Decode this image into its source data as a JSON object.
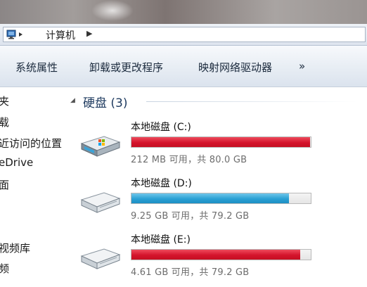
{
  "address": {
    "path": "计算机"
  },
  "toolbar": {
    "buttons": [
      {
        "label": "系统属性"
      },
      {
        "label": "卸载或更改程序"
      },
      {
        "label": "映射网络驱动器"
      }
    ],
    "more": "»"
  },
  "nav": {
    "items": [
      {
        "label": "夹"
      },
      {
        "label": "载"
      },
      {
        "label": "近访问的位置"
      },
      {
        "label": "eDrive"
      },
      {
        "label": "面"
      },
      {
        "label": "视频库"
      },
      {
        "label": "频"
      }
    ]
  },
  "group": {
    "title": "硬盘 (3)",
    "collapse_icon": "triangle-collapse-icon"
  },
  "drives": [
    {
      "name": "本地磁盘 (C:)",
      "info": "212 MB 可用，共 80.0 GB",
      "used_fraction": 0.997,
      "color": "#d4142c",
      "icon": "windows-drive-icon"
    },
    {
      "name": "本地磁盘 (D:)",
      "info": "9.25 GB 可用，共 79.2 GB",
      "used_fraction": 0.88,
      "color": "#2aa0d4",
      "icon": "hard-drive-icon"
    },
    {
      "name": "本地磁盘 (E:)",
      "info": "4.61 GB 可用，共 79.2 GB",
      "used_fraction": 0.94,
      "color": "#d4142c",
      "icon": "hard-drive-icon"
    }
  ]
}
